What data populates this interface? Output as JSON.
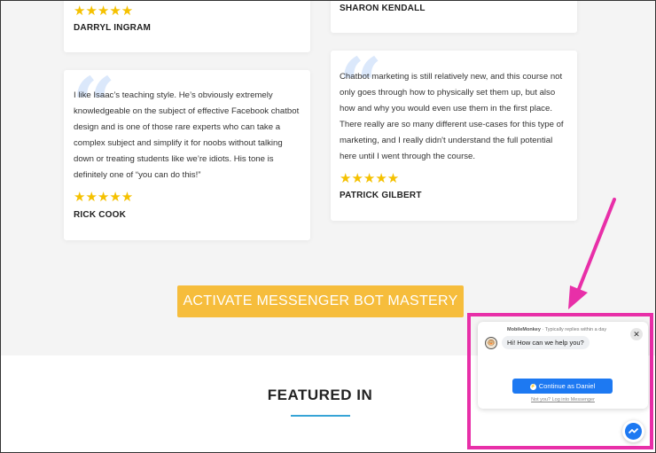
{
  "testimonials": [
    {
      "name": "DARRYL INGRAM",
      "stars": "★★★★★"
    },
    {
      "name": "SHARON KENDALL"
    },
    {
      "text": "I like Isaac’s teaching style. He’s obviously extremely knowledgeable on the subject of effective Facebook chatbot design and is one of those rare experts who can take a complex subject and simplify it for noobs without talking down or treating students like we’re idiots. His tone is definitely one of “you can do this!”",
      "name": "RICK COOK",
      "stars": "★★★★★"
    },
    {
      "text": "Chatbot marketing is still relatively new, and this course not only goes through how to physically set them up, but also how and why you would even use them in the first place. There really are so many different use-cases for this type of marketing, and I really didn't understand the full potential here until I went through the course.",
      "name": "PATRICK GILBERT",
      "stars": "★★★★★"
    }
  ],
  "quote_glyph": "“",
  "cta": {
    "label": "ACTIVATE MESSENGER BOT MASTERY"
  },
  "featured": {
    "title": "FEATURED IN"
  },
  "chat": {
    "page_name": "MobileMonkey",
    "reply_time": " · Typically replies within a day",
    "greeting": "Hi! How can we help you?",
    "close_glyph": "✕",
    "continue_label": "Continue as Daniel",
    "not_you": "Not you? Log into Messenger"
  },
  "colors": {
    "accent_cta": "#f6bd3c",
    "star": "#f5c100",
    "messenger_blue": "#1d79f2",
    "highlight": "#e82fa8",
    "featured_underline": "#36a4d6"
  },
  "icons": [
    "star-icon",
    "quote-icon",
    "close-icon",
    "messenger-icon",
    "avatar-icon",
    "arrow-annotation"
  ]
}
